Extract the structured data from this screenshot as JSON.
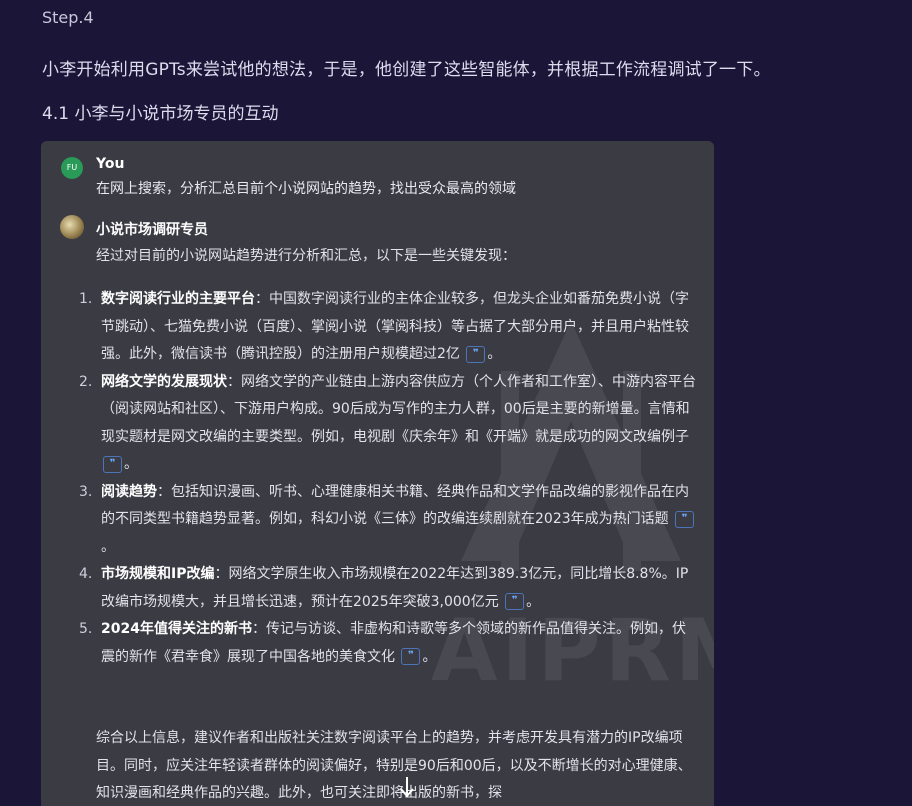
{
  "step": "Step.4",
  "intro": "小李开始利用GPTs来尝试他的想法，于是，他创建了这些智能体，并根据工作流程调试了一下。",
  "subtitle": "4.1 小李与小说市场专员的互动",
  "watermark": "AIPRM",
  "user": {
    "avatar": "FU",
    "name": "You",
    "message": "在网上搜索，分析汇总目前个小说网站的趋势，找出受众最高的领域"
  },
  "bot": {
    "name": "小说市场调研专员",
    "intro": "经过对目前的小说网站趋势进行分析和汇总，以下是一些关键发现：",
    "items": [
      {
        "num": "1.",
        "title": "数字阅读行业的主要平台",
        "text": "：中国数字阅读行业的主体企业较多，但龙头企业如番茄免费小说（字节跳动）、七猫免费小说（百度）、掌阅小说（掌阅科技）等占据了大部分用户，并且用户粘性较强。此外，微信读书（腾讯控股）的注册用户规模超过2亿",
        "end": "。"
      },
      {
        "num": "2.",
        "title": "网络文学的发展现状",
        "text": "：网络文学的产业链由上游内容供应方（个人作者和工作室）、中游内容平台（阅读网站和社区）、下游用户构成。90后成为写作的主力人群，00后是主要的新增量。言情和现实题材是网文改编的主要类型。例如，电视剧《庆余年》和《开端》就是成功的网文改编例子",
        "end": "。"
      },
      {
        "num": "3.",
        "title": "阅读趋势",
        "text": "：包括知识漫画、听书、心理健康相关书籍、经典作品和文学作品改编的影视作品在内的不同类型书籍趋势显著。例如，科幻小说《三体》的改编连续剧就在2023年成为热门话题",
        "end": "。"
      },
      {
        "num": "4.",
        "title": "市场规模和IP改编",
        "text": "：网络文学原生收入市场规模在2022年达到389.3亿元，同比增长8.8%。IP改编市场规模大，并且增长迅速，预计在2025年突破3,000亿元",
        "end": "。"
      },
      {
        "num": "5.",
        "title": "2024年值得关注的新书",
        "text": "：传记与访谈、非虚构和诗歌等多个领域的新作品值得关注。例如，伏震的新作《君幸食》展现了中国各地的美食文化",
        "end": "。"
      }
    ],
    "cite_glyph": "❞",
    "summary": "综合以上信息，建议作者和出版社关注数字阅读平台上的趋势，并考虑开发具有潜力的IP改编项目。同时，应关注年轻读者群体的阅读偏好，特别是90后和00后，以及不断增长的对心理健康、知识漫画和经典作品的兴趣。此外，也可关注即将出版的新书，探"
  },
  "colors": {
    "background": "#1b1638",
    "chat_bg": "#3b3b44",
    "cite": "#6fa8ff",
    "you_avatar": "#2a9a58"
  }
}
